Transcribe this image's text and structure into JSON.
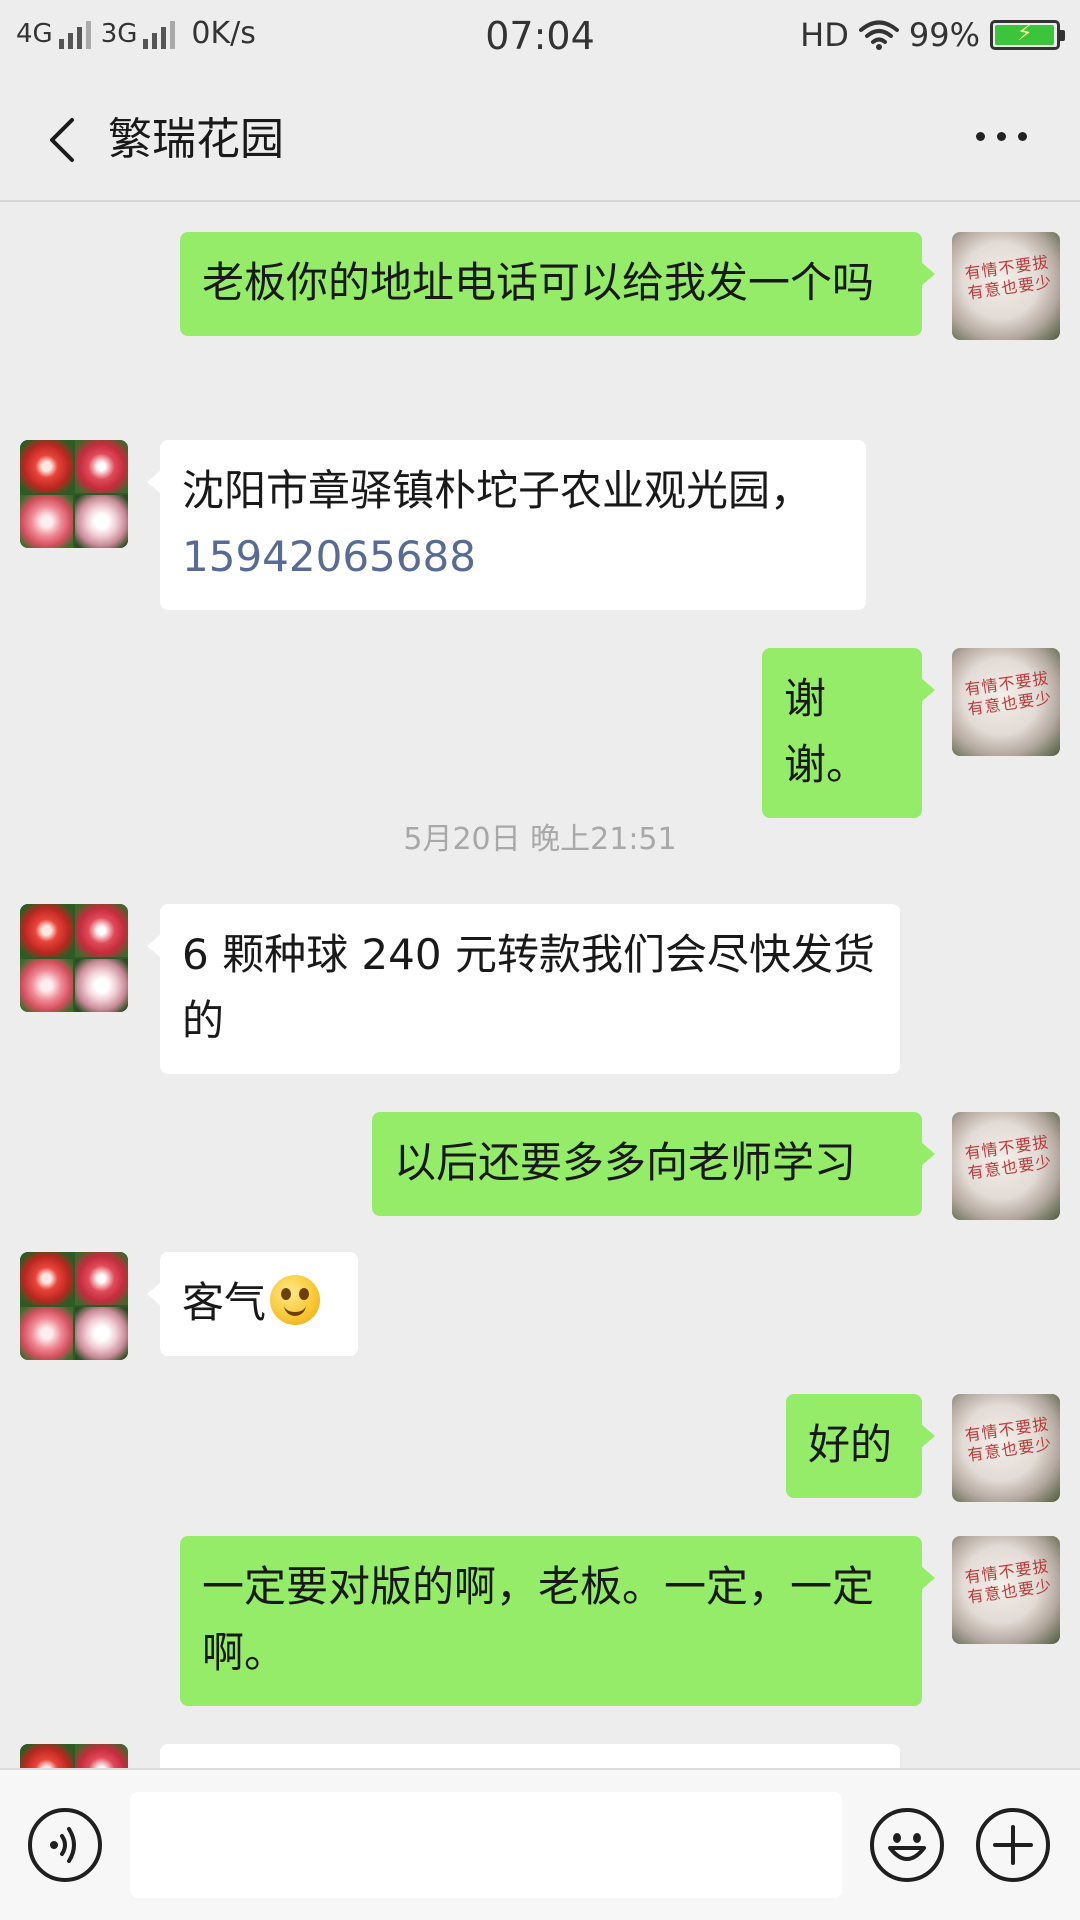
{
  "status_bar": {
    "net1": "4G",
    "net2": "3G",
    "speed": "0K/s",
    "time": "07:04",
    "hd": "HD",
    "battery": "99%",
    "battery_level": 0.99
  },
  "header": {
    "title": "繁瑞花园"
  },
  "messages": [
    {
      "side": "me",
      "text": "老板你的地址电话可以给我发一个吗"
    },
    {
      "side": "them",
      "text": "沈阳市章驿镇朴坨子农业观光园，",
      "phone": "15942065688"
    },
    {
      "side": "me",
      "text": "谢谢。"
    },
    {
      "type": "time",
      "text": "5月20日 晚上21:51"
    },
    {
      "side": "them",
      "text": "6 颗种球 240 元转款我们会尽快发货的"
    },
    {
      "side": "me",
      "text": "以后还要多多向老师学习"
    },
    {
      "side": "them",
      "text": "客气",
      "emoji": "smile-emoji"
    },
    {
      "side": "me",
      "text": "好的"
    },
    {
      "side": "me",
      "text": "一定要对版的啊，老板。一定，一定啊。"
    }
  ],
  "avatars": {
    "me_ink": "有情不要拔\n有意也要少",
    "them": "flower-collage"
  },
  "input": {
    "value": "",
    "placeholder": ""
  },
  "colors": {
    "background": "#ededed",
    "bubble_me": "#95ec69",
    "bubble_them": "#ffffff",
    "link": "#576b95",
    "timestamp": "#a8a8a8"
  },
  "icons": [
    "back-arrow-icon",
    "more-icon",
    "voice-icon",
    "emoji-icon",
    "plus-icon"
  ]
}
